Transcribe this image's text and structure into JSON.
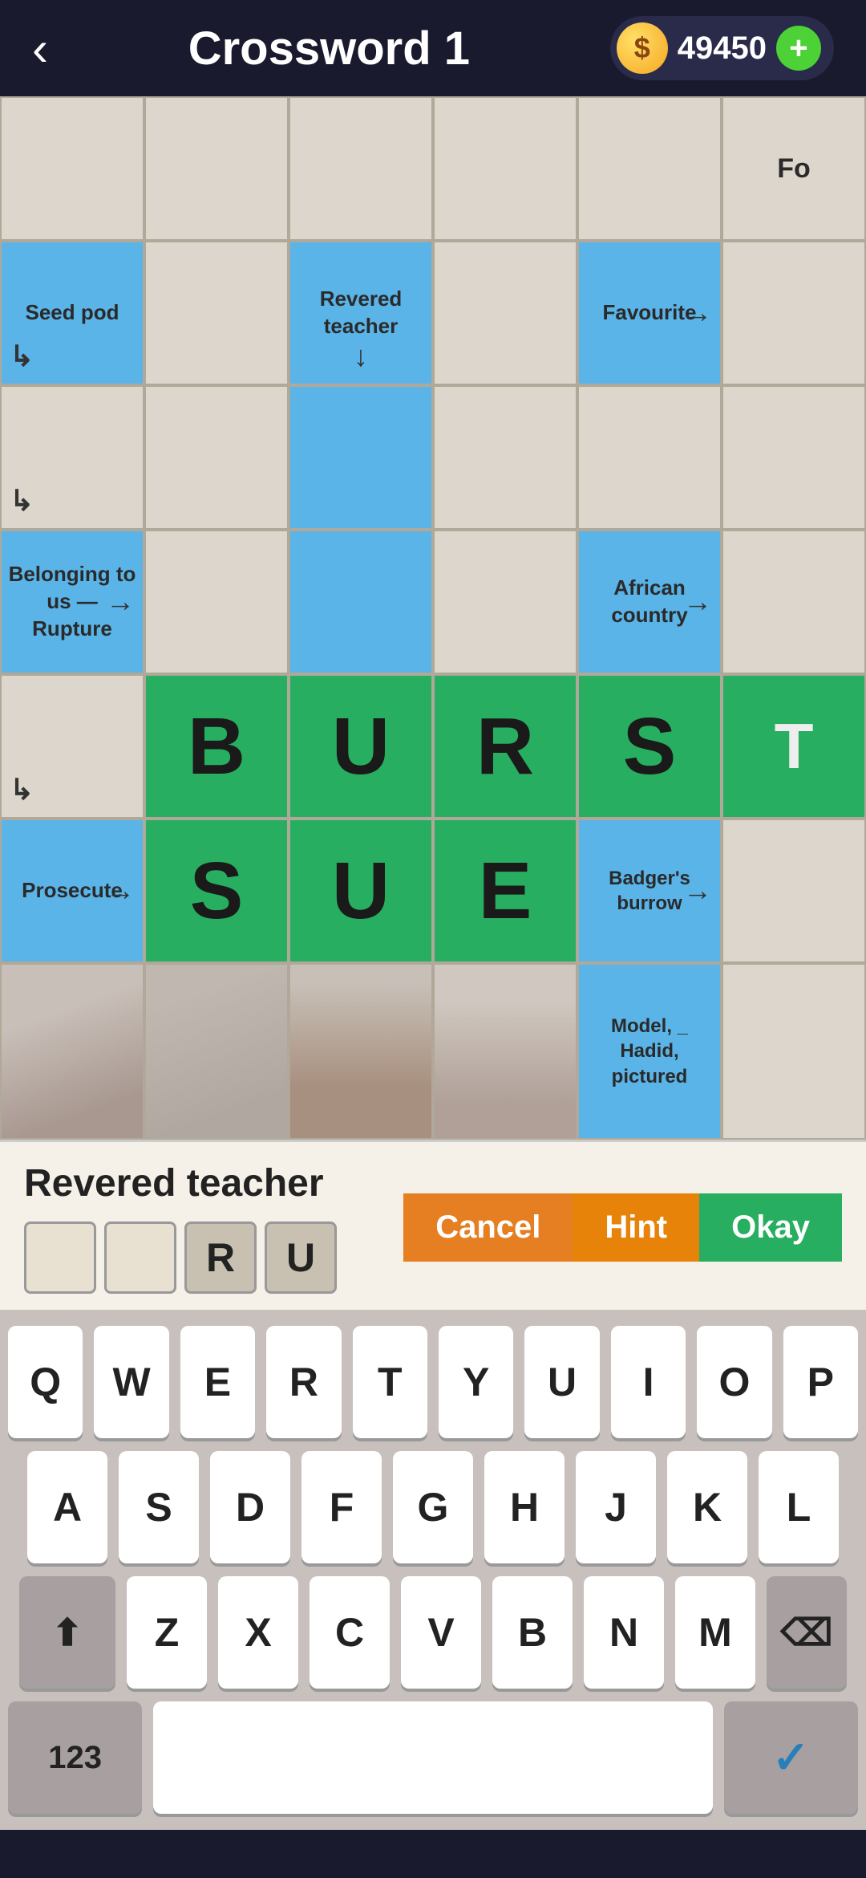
{
  "header": {
    "back_label": "‹",
    "title": "Crossword 1",
    "coin_symbol": "⊙",
    "coin_amount": "49450",
    "add_label": "+"
  },
  "grid": {
    "rows": [
      [
        {
          "type": "empty",
          "text": ""
        },
        {
          "type": "empty",
          "text": ""
        },
        {
          "type": "empty",
          "text": ""
        },
        {
          "type": "empty",
          "text": ""
        },
        {
          "type": "empty",
          "text": ""
        },
        {
          "type": "empty",
          "text": "Fo"
        }
      ],
      [
        {
          "type": "clue-blue",
          "text": "Seed pod",
          "arrow": "corner-right"
        },
        {
          "type": "empty",
          "text": ""
        },
        {
          "type": "clue-blue",
          "text": "Revered teacher",
          "arrow": "down"
        },
        {
          "type": "empty",
          "text": ""
        },
        {
          "type": "clue-blue",
          "text": "Favourite",
          "arrow": "right"
        },
        {
          "type": "empty",
          "text": ""
        }
      ],
      [
        {
          "type": "empty",
          "text": "",
          "arrow": "corner-right"
        },
        {
          "type": "empty",
          "text": ""
        },
        {
          "type": "clue-blue",
          "text": ""
        },
        {
          "type": "empty",
          "text": ""
        },
        {
          "type": "empty",
          "text": ""
        },
        {
          "type": "empty",
          "text": ""
        }
      ],
      [
        {
          "type": "clue-blue",
          "text": "Belonging to us — Rupture",
          "arrow": "right"
        },
        {
          "type": "empty",
          "text": ""
        },
        {
          "type": "clue-blue",
          "text": ""
        },
        {
          "type": "empty",
          "text": ""
        },
        {
          "type": "clue-blue",
          "text": "African country",
          "arrow": "right"
        },
        {
          "type": "empty",
          "text": ""
        }
      ],
      [
        {
          "type": "empty",
          "text": "",
          "arrow": "corner-right"
        },
        {
          "type": "answer-green",
          "text": "B"
        },
        {
          "type": "answer-green",
          "text": "U"
        },
        {
          "type": "answer-green",
          "text": "R"
        },
        {
          "type": "answer-green",
          "text": "S"
        },
        {
          "type": "answer-partial",
          "text": "T"
        }
      ],
      [
        {
          "type": "clue-blue",
          "text": "Prosecute",
          "arrow": "right"
        },
        {
          "type": "answer-green",
          "text": "S"
        },
        {
          "type": "answer-green",
          "text": "U"
        },
        {
          "type": "answer-green",
          "text": "E"
        },
        {
          "type": "clue-blue",
          "text": "Badger's burrow",
          "arrow": "right"
        },
        {
          "type": "empty",
          "text": ""
        }
      ],
      [
        {
          "type": "image",
          "text": ""
        },
        {
          "type": "image",
          "text": ""
        },
        {
          "type": "image",
          "text": ""
        },
        {
          "type": "image",
          "text": ""
        },
        {
          "type": "clue-blue",
          "text": "Model, _ Hadid, pictured"
        },
        {
          "type": "empty",
          "text": ""
        }
      ]
    ]
  },
  "clue_bar": {
    "clue_text": "Revered teacher",
    "answer_boxes": [
      {
        "value": "",
        "filled": false
      },
      {
        "value": "",
        "filled": false
      },
      {
        "value": "R",
        "filled": true
      },
      {
        "value": "U",
        "filled": true
      }
    ],
    "cancel_label": "Cancel",
    "hint_label": "Hint",
    "okay_label": "Okay"
  },
  "keyboard": {
    "row1": [
      "Q",
      "W",
      "E",
      "R",
      "T",
      "Y",
      "U",
      "I",
      "O",
      "P"
    ],
    "row2": [
      "A",
      "S",
      "D",
      "F",
      "G",
      "H",
      "J",
      "K",
      "L"
    ],
    "row3_shift": "⬆",
    "row3": [
      "Z",
      "X",
      "C",
      "V",
      "B",
      "N",
      "M"
    ],
    "row3_back": "⌫",
    "bottom_123": "123",
    "bottom_done_icon": "✓"
  }
}
